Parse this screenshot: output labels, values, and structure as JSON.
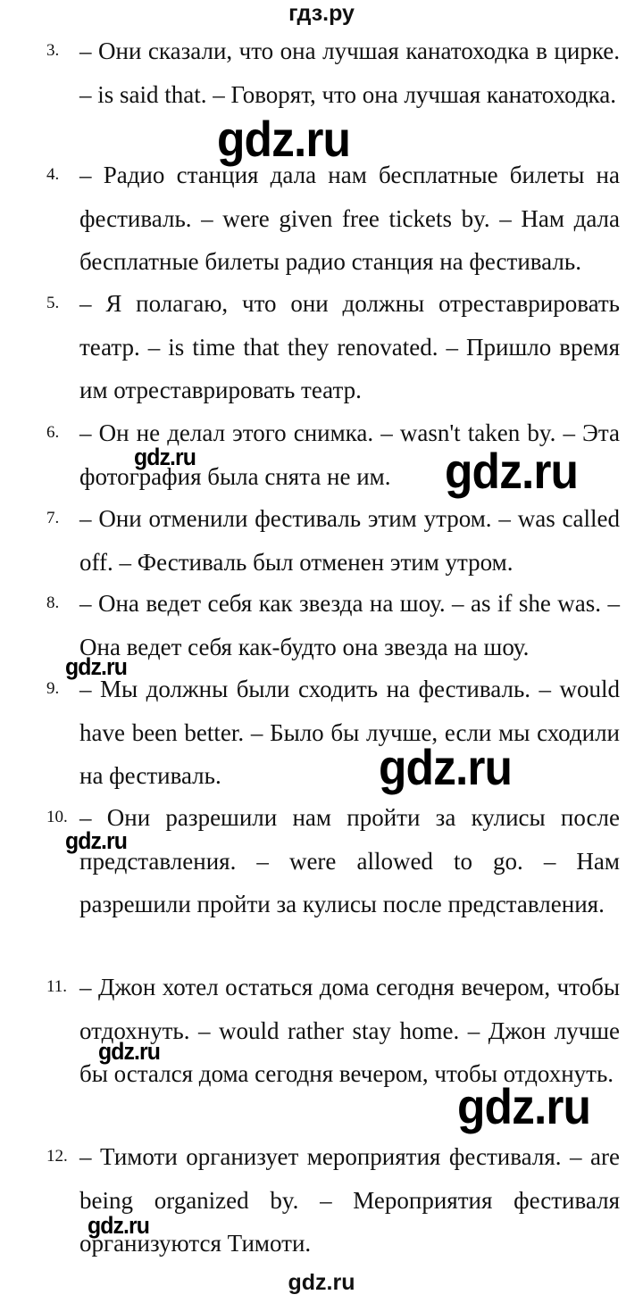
{
  "header": {
    "title": "гдз.ру"
  },
  "footer": {
    "watermark": "gdz.ru"
  },
  "watermark_text": "gdz.ru",
  "items": [
    {
      "number": "3.",
      "text": "– Они сказали, что она лучшая канатоходка в цирке. – is said that. – Говорят, что она лучшая канатоходка."
    },
    {
      "number": "4.",
      "text": "– Радио станция дала нам бесплатные билеты на фестиваль. – were given free tickets by. – Нам дала бесплатные билеты радио станция на фестиваль."
    },
    {
      "number": "5.",
      "text": "– Я полагаю, что они должны отреставрировать театр. – is time that they renovated. – Пришло время им отреставрировать театр."
    },
    {
      "number": "6.",
      "text": "– Он не делал этого снимка. – wasn't taken by. – Эта фотография была снята не им."
    },
    {
      "number": "7.",
      "text": "– Они отменили фестиваль этим утром. – was called off. – Фестиваль был отменен этим утром."
    },
    {
      "number": "8.",
      "text": "– Она ведет себя как звезда на шоу. – as if she was. – Она ведет себя как-будто она звезда на шоу."
    },
    {
      "number": "9.",
      "text": "– Мы должны были сходить на фестиваль. – would have been better. – Было бы лучше, если мы сходили на фестиваль."
    },
    {
      "number": "10.",
      "text": "– Они разрешили нам пройти за кулисы после представления. – were allowed to go. – Нам разрешили пройти за кулисы после представления."
    },
    {
      "number": "11.",
      "text": "– Джон хотел остаться дома сегодня вечером, чтобы отдохнуть. – would rather stay home. – Джон лучше бы остался дома сегодня вечером, чтобы отдохнуть."
    },
    {
      "number": "12.",
      "text": "– Тимоти организует мероприятия фестиваля. – are being organized by. – Мероприятия фестиваля организуются Тимоти."
    }
  ]
}
